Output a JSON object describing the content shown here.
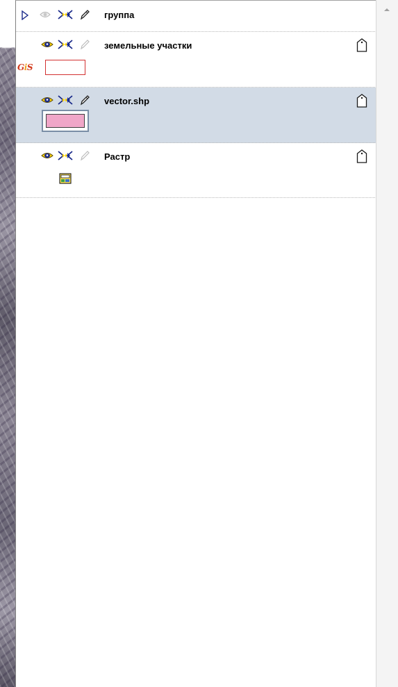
{
  "layers": [
    {
      "name": "группа",
      "type": "group"
    },
    {
      "name": "земельные участки",
      "type": "vector",
      "legend_badge": "GIS",
      "swatch": {
        "fill": "#ffffff",
        "stroke": "#d23030"
      }
    },
    {
      "name": "vector.shp",
      "type": "vector",
      "selected": true,
      "swatch": {
        "fill": "#f0a6c8",
        "stroke": "#404040"
      }
    },
    {
      "name": "Растр",
      "type": "raster"
    }
  ],
  "colors": {
    "selection": "#d2dbe6",
    "accent_yellow": "#ffd200",
    "eye_blue": "#1a2a8a"
  },
  "icons": [
    "expand-triangle-icon",
    "visibility-eye-icon",
    "selectable-arrows-icon",
    "edit-pencil-icon",
    "tag-icon",
    "raster-icon",
    "scroll-up-arrow-icon"
  ]
}
